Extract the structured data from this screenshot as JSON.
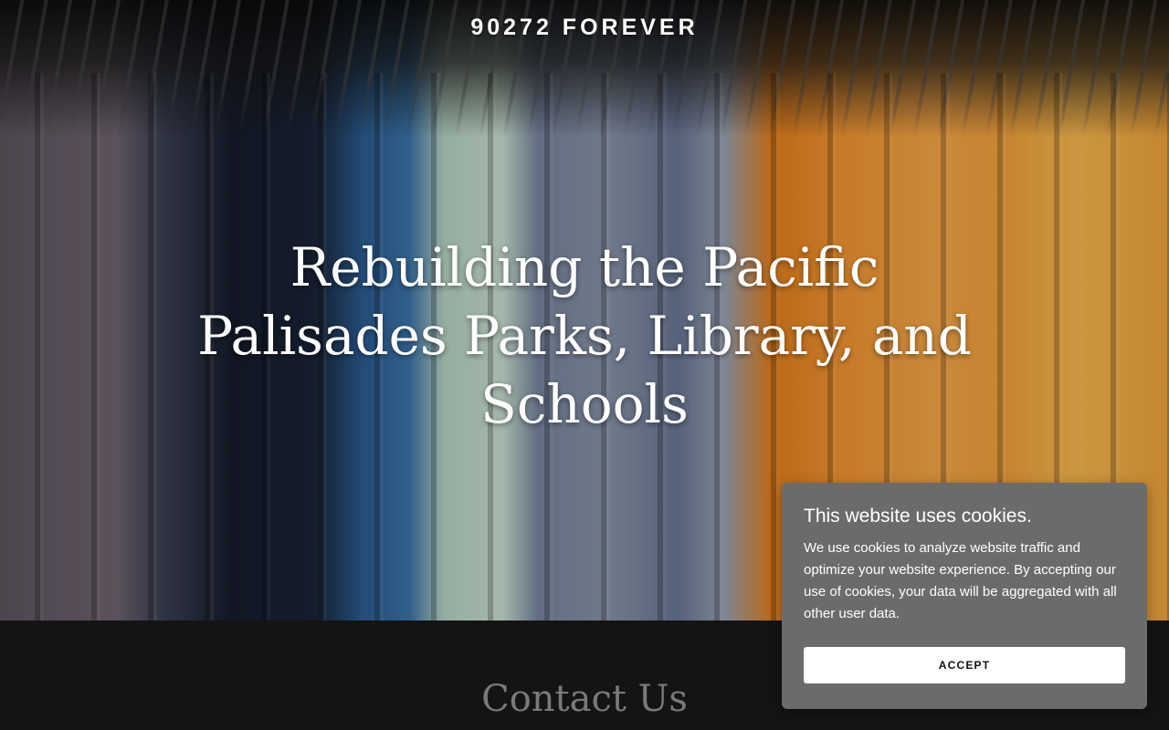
{
  "header": {
    "brand": "90272 FOREVER"
  },
  "hero": {
    "title": "Rebuilding the Pacific Palisades Parks, Library, and Schools",
    "image": "clothing-rack-photo"
  },
  "contact": {
    "title": "Contact Us"
  },
  "cookie_banner": {
    "title": "This website uses cookies.",
    "text": "We use cookies to analyze website traffic and optimize your website experience. By accepting our use of cookies, your data will be aggregated with all other user data.",
    "accept_label": "ACCEPT"
  },
  "colors": {
    "page_background": "#141414",
    "banner_background": "#6b6b6b",
    "button_background": "#ffffff",
    "contact_title": "#7a7a7a"
  }
}
